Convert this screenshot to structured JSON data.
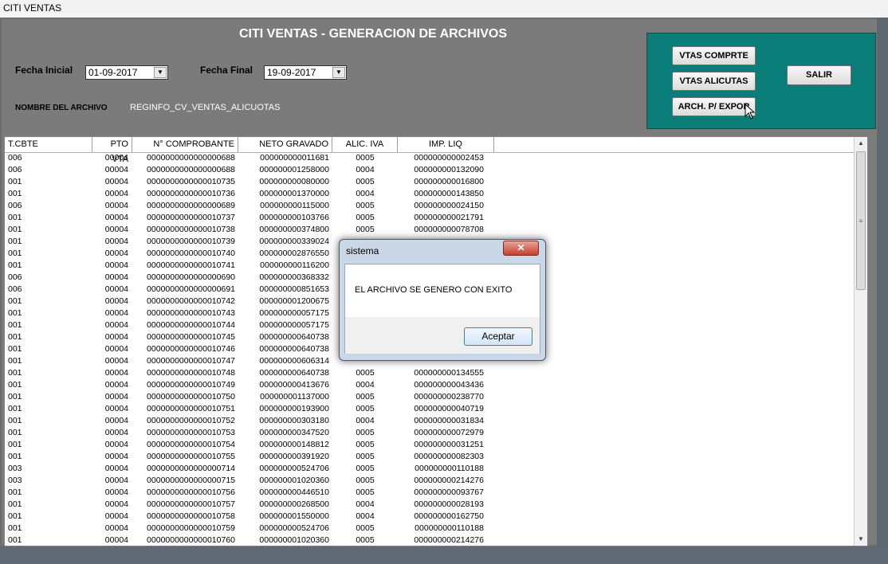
{
  "window": {
    "title": "CITI VENTAS"
  },
  "header": {
    "title": "CITI VENTAS - GENERACION DE ARCHIVOS",
    "fecha_inicial_label": "Fecha Inicial",
    "fecha_inicial_value": "01-09-2017",
    "fecha_final_label": "Fecha Final",
    "fecha_final_value": "19-09-2017",
    "archivo_label": "NOMBRE DEL ARCHIVO",
    "archivo_value": "REGINFO_CV_VENTAS_ALICUOTAS"
  },
  "actions": {
    "vtas_comprte": "VTAS COMPRTE",
    "vtas_alicutas": "VTAS ALICUTAS",
    "arch_expor": "ARCH. P/ EXPOR",
    "salir": "SALIR",
    "accent_color": "#0b7d78"
  },
  "grid": {
    "columns": [
      "T.CBTE",
      "PTO VTA",
      "N° COMPROBANTE",
      "NETO GRAVADO",
      "ALIC. IVA",
      "IMP. LIQ"
    ],
    "rows": [
      [
        "006",
        "00004",
        "0000000000000000688",
        "000000000011681",
        "0005",
        "000000000002453"
      ],
      [
        "006",
        "00004",
        "0000000000000000688",
        "000000001258000",
        "0004",
        "000000000132090"
      ],
      [
        "001",
        "00004",
        "0000000000000010735",
        "000000000080000",
        "0005",
        "000000000016800"
      ],
      [
        "001",
        "00004",
        "0000000000000010736",
        "000000001370000",
        "0004",
        "000000000143850"
      ],
      [
        "006",
        "00004",
        "0000000000000000689",
        "000000000115000",
        "0005",
        "000000000024150"
      ],
      [
        "001",
        "00004",
        "0000000000000010737",
        "000000000103766",
        "0005",
        "000000000021791"
      ],
      [
        "001",
        "00004",
        "0000000000000010738",
        "000000000374800",
        "0005",
        "000000000078708"
      ],
      [
        "001",
        "00004",
        "0000000000000010739",
        "000000000339024",
        "",
        ""
      ],
      [
        "001",
        "00004",
        "0000000000000010740",
        "000000002876550",
        "",
        ""
      ],
      [
        "001",
        "00004",
        "0000000000000010741",
        "000000000116200",
        "",
        ""
      ],
      [
        "006",
        "00004",
        "0000000000000000690",
        "000000000368332",
        "",
        ""
      ],
      [
        "006",
        "00004",
        "0000000000000000691",
        "000000000851653",
        "",
        ""
      ],
      [
        "001",
        "00004",
        "0000000000000010742",
        "000000001200675",
        "",
        ""
      ],
      [
        "001",
        "00004",
        "0000000000000010743",
        "000000000057175",
        "",
        ""
      ],
      [
        "001",
        "00004",
        "0000000000000010744",
        "000000000057175",
        "",
        ""
      ],
      [
        "001",
        "00004",
        "0000000000000010745",
        "000000000640738",
        "",
        ""
      ],
      [
        "001",
        "00004",
        "0000000000000010746",
        "000000000640738",
        "",
        ""
      ],
      [
        "001",
        "00004",
        "0000000000000010747",
        "000000000606314",
        "",
        ""
      ],
      [
        "001",
        "00004",
        "0000000000000010748",
        "000000000640738",
        "0005",
        "000000000134555"
      ],
      [
        "001",
        "00004",
        "0000000000000010749",
        "000000000413676",
        "0004",
        "000000000043436"
      ],
      [
        "001",
        "00004",
        "0000000000000010750",
        "000000001137000",
        "0005",
        "000000000238770"
      ],
      [
        "001",
        "00004",
        "0000000000000010751",
        "000000000193900",
        "0005",
        "000000000040719"
      ],
      [
        "001",
        "00004",
        "0000000000000010752",
        "000000000303180",
        "0004",
        "000000000031834"
      ],
      [
        "001",
        "00004",
        "0000000000000010753",
        "000000000347520",
        "0005",
        "000000000072979"
      ],
      [
        "001",
        "00004",
        "0000000000000010754",
        "000000000148812",
        "0005",
        "000000000031251"
      ],
      [
        "001",
        "00004",
        "0000000000000010755",
        "000000000391920",
        "0005",
        "000000000082303"
      ],
      [
        "003",
        "00004",
        "0000000000000000714",
        "000000000524706",
        "0005",
        "000000000110188"
      ],
      [
        "003",
        "00004",
        "0000000000000000715",
        "000000001020360",
        "0005",
        "000000000214276"
      ],
      [
        "001",
        "00004",
        "0000000000000010756",
        "000000000446510",
        "0005",
        "000000000093767"
      ],
      [
        "001",
        "00004",
        "0000000000000010757",
        "000000000268500",
        "0004",
        "000000000028193"
      ],
      [
        "001",
        "00004",
        "0000000000000010758",
        "000000001550000",
        "0004",
        "000000000162750"
      ],
      [
        "001",
        "00004",
        "0000000000000010759",
        "000000000524706",
        "0005",
        "000000000110188"
      ],
      [
        "001",
        "00004",
        "0000000000000010760",
        "000000001020360",
        "0005",
        "000000000214276"
      ]
    ]
  },
  "dialog": {
    "title": "sistema",
    "message": "EL ARCHIVO SE GENERO CON EXITO",
    "ok": "Aceptar",
    "close": "✕"
  }
}
